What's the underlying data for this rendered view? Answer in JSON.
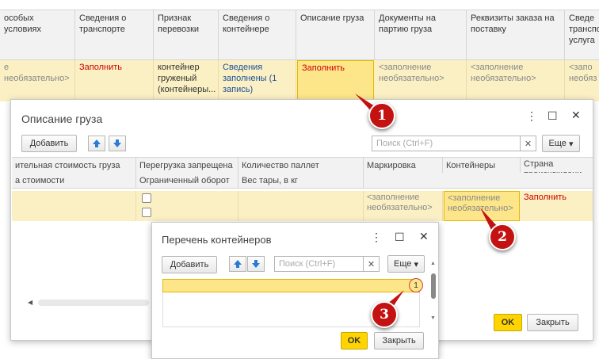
{
  "bg": {
    "headers": [
      "особых условиях",
      "Сведения о транспорте",
      "Признак перевозки",
      "Сведения о контейнере",
      "Описание груза",
      "Документы на партию груза",
      "Реквизиты заказа на поставку",
      "Сведе транспо услуга"
    ],
    "row": [
      "е необязательно>",
      "Заполнить",
      "контейнер груженый (контейнеры...",
      "Сведения заполнены (1 запись)",
      "Заполнить",
      "<заполнение необязательно>",
      "<заполнение необязательно>",
      "<запо необяз"
    ]
  },
  "dlg1": {
    "title": "Описание груза",
    "add_label": "Добавить",
    "search_placeholder": "Поиск (Ctrl+F)",
    "more_label": "Еще",
    "headers_top": [
      "ительная стоимость груза",
      "Перегрузка запрещена",
      "Количество паллет",
      "Маркировка",
      "Контейнеры",
      "Страна происхождени"
    ],
    "headers_bottom": [
      "а стоимости",
      "Ограниченный оборот",
      "Вес тары, в кг"
    ],
    "row": {
      "marking": "<заполнение необязательно>",
      "containers": "<заполнение необязательно>",
      "country": "Заполнить"
    },
    "ok_label": "OK",
    "close_label": "Закрыть"
  },
  "dlg2": {
    "title": "Перечень контейнеров",
    "add_label": "Добавить",
    "search_placeholder": "Поиск (Ctrl+F)",
    "more_label": "Еще",
    "ok_label": "OK",
    "close_label": "Закрыть",
    "row_marker": "1"
  },
  "markers": [
    "1",
    "2",
    "3"
  ],
  "colors": {
    "accent_yellow": "#ffd400",
    "marker_red": "#c41212",
    "link_red": "#cc0000",
    "link_blue": "#1c4f9c"
  }
}
